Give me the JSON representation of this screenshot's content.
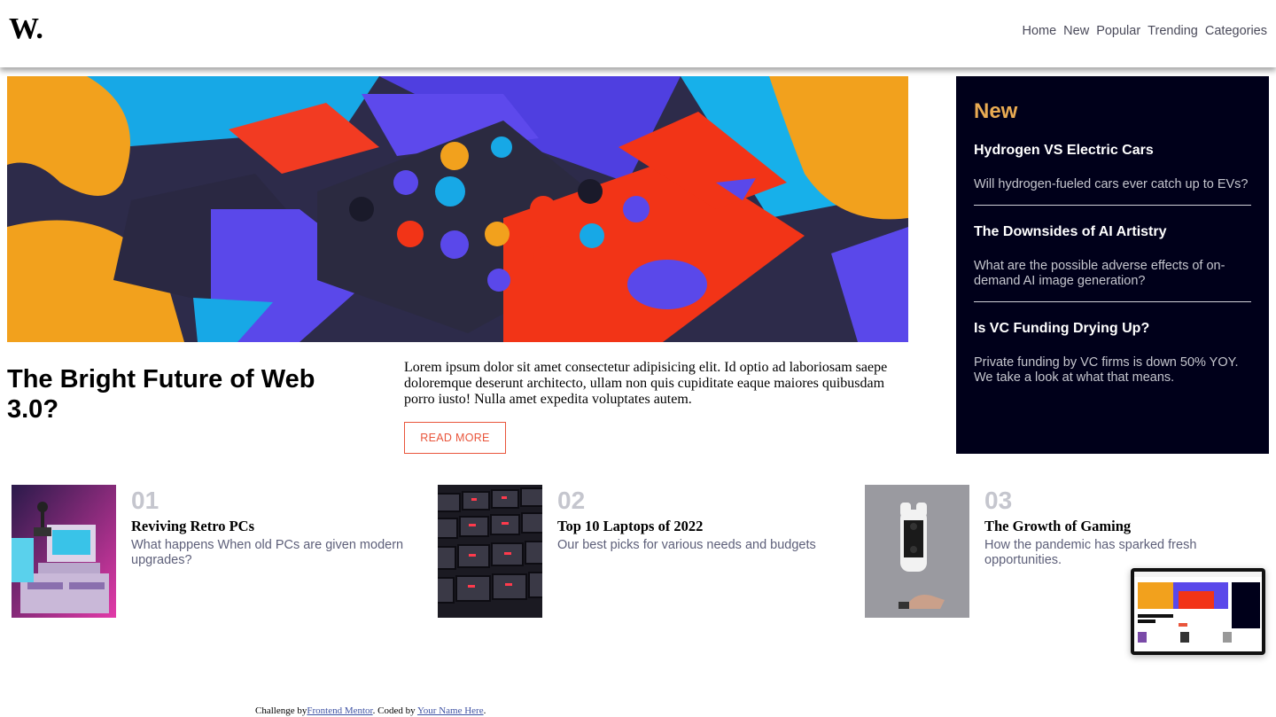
{
  "header": {
    "logo": "W.",
    "nav": [
      "Home",
      "New",
      "Popular",
      "Trending",
      "Categories"
    ]
  },
  "featured": {
    "title": "The Bright Future of Web 3.0?",
    "body": "Lorem ipsum dolor sit amet consectetur adipisicing elit. Id optio ad laboriosam saepe doloremque deserunt architecto, ullam non quis cupiditate eaque maiores quibusdam porro iusto! Nulla amet expedita voluptates autem.",
    "cta": "READ MORE"
  },
  "new_panel": {
    "heading": "New",
    "items": [
      {
        "title": "Hydrogen VS Electric Cars",
        "desc": "Will hydrogen-fueled cars ever catch up to EVs?"
      },
      {
        "title": "The Downsides of AI Artistry",
        "desc": "What are the possible adverse effects of on-demand AI image generation?"
      },
      {
        "title": "Is VC Funding Drying Up?",
        "desc": "Private funding by VC firms is down 50% YOY. We take a look at what that means."
      }
    ]
  },
  "cards": [
    {
      "num": "01",
      "title": "Reviving Retro PCs",
      "desc": "What happens When old PCs are given modern upgrades?"
    },
    {
      "num": "02",
      "title": "Top 10 Laptops of 2022",
      "desc": "Our best picks for various needs and budgets"
    },
    {
      "num": "03",
      "title": "The Growth of Gaming",
      "desc": "How the pandemic has sparked fresh opportunities."
    }
  ],
  "footer": {
    "prefix": "Challenge by",
    "link1": "Frontend Mentor",
    "middle": ". Coded by",
    "link2": "Your Name Here",
    "suffix": "."
  },
  "colors": {
    "accent_orange": "#e9ab53",
    "accent_red": "#e9553b",
    "dark_navy": "#00001a",
    "muted_gray": "#c5c6ce"
  }
}
